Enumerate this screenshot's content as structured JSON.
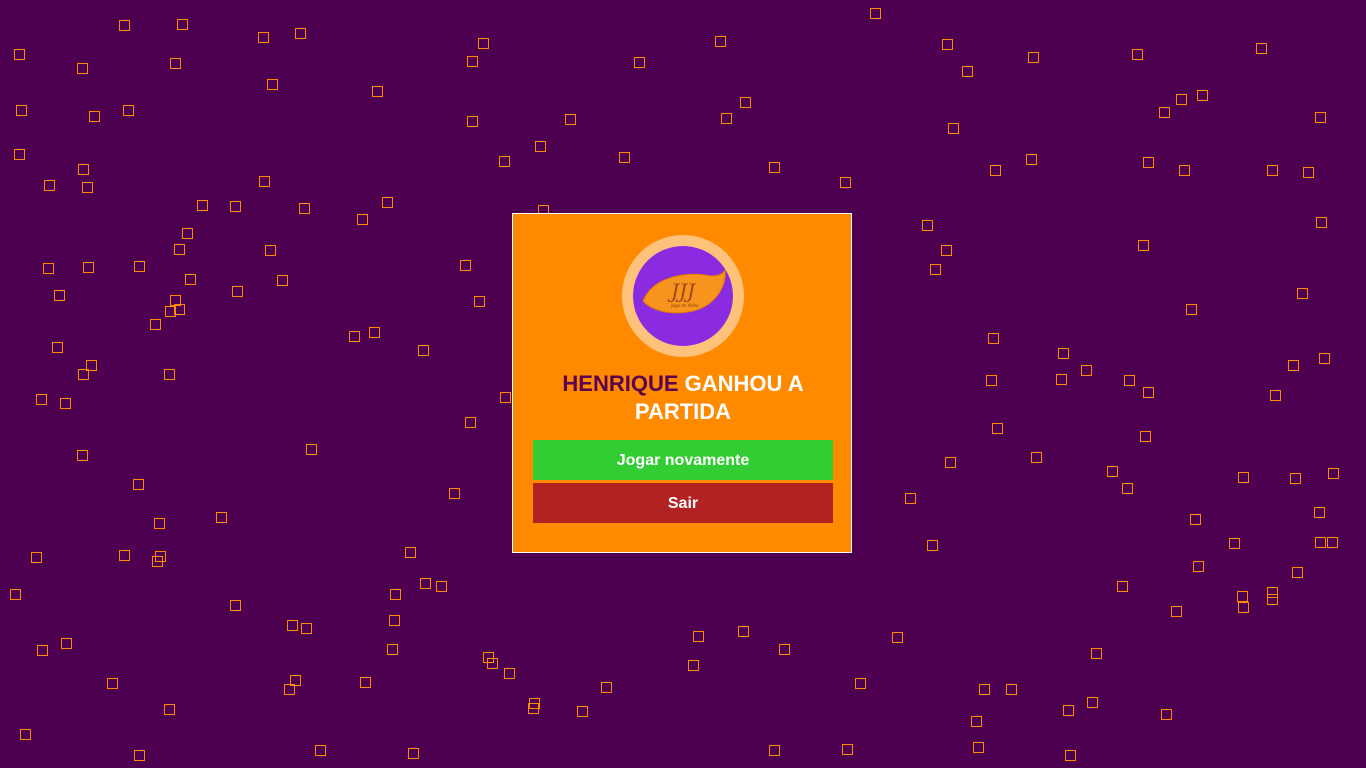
{
  "dialog": {
    "winner_name": "HENRIQUE",
    "winner_suffix": " GANHOU A PARTIDA",
    "play_again_label": "Jogar novamente",
    "exit_label": "Sair"
  },
  "logo": {
    "text": "JJJ",
    "tagline": "Jogo da Velha"
  },
  "colors": {
    "background": "#4d0050",
    "square_outline": "#ff8a00",
    "dialog_bg": "#ff8a00",
    "winner_name": "#5a0050",
    "play_button": "#32cd32",
    "exit_button": "#b22222",
    "logo_ring": "#ffc27a",
    "logo_core": "#8a2be2"
  }
}
